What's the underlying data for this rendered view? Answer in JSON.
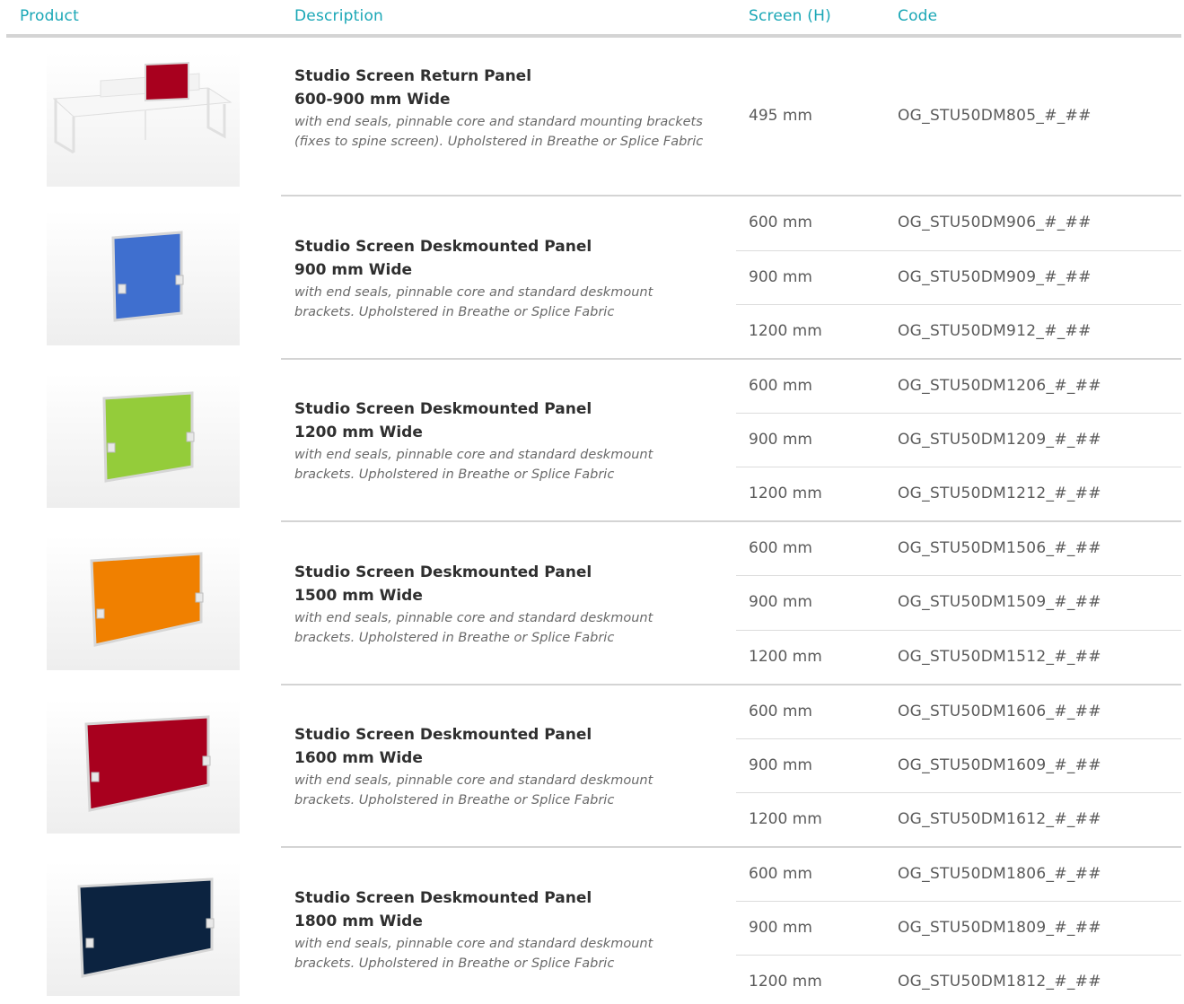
{
  "headers": {
    "product": "Product",
    "description": "Description",
    "screen_h": "Screen (H)",
    "code": "Code"
  },
  "colors": {
    "accent": "#1aa7b6",
    "return_panel": "#a8001e",
    "panel_900": "#3f6fcf",
    "panel_1200": "#94cc3a",
    "panel_1500": "#f08000",
    "panel_1600": "#a8001e",
    "panel_1800": "#0c2340"
  },
  "products": [
    {
      "name": "Studio Screen Return Panel",
      "width": "600-900 mm Wide",
      "details": "with end seals, pinnable core and standard mounting brackets (fixes to spine screen). Upholstered in Breathe or Splice Fabric",
      "variants": [
        {
          "height": "495 mm",
          "code": "OG_STU50DM805_#_##"
        }
      ]
    },
    {
      "name": "Studio Screen Deskmounted Panel",
      "width": "900 mm Wide",
      "details": "with end seals, pinnable core and standard deskmount brackets. Upholstered in Breathe or Splice Fabric",
      "variants": [
        {
          "height": "600 mm",
          "code": "OG_STU50DM906_#_##"
        },
        {
          "height": "900 mm",
          "code": "OG_STU50DM909_#_##"
        },
        {
          "height": "1200 mm",
          "code": "OG_STU50DM912_#_##"
        }
      ]
    },
    {
      "name": "Studio Screen Deskmounted Panel",
      "width": "1200 mm Wide",
      "details": "with end seals, pinnable core and standard deskmount brackets. Upholstered in Breathe or Splice Fabric",
      "variants": [
        {
          "height": "600 mm",
          "code": "OG_STU50DM1206_#_##"
        },
        {
          "height": "900 mm",
          "code": "OG_STU50DM1209_#_##"
        },
        {
          "height": "1200 mm",
          "code": "OG_STU50DM1212_#_##"
        }
      ]
    },
    {
      "name": "Studio Screen Deskmounted Panel",
      "width": "1500 mm Wide",
      "details": "with end seals, pinnable core and standard deskmount brackets. Upholstered in Breathe or Splice Fabric",
      "variants": [
        {
          "height": "600 mm",
          "code": "OG_STU50DM1506_#_##"
        },
        {
          "height": "900 mm",
          "code": "OG_STU50DM1509_#_##"
        },
        {
          "height": "1200 mm",
          "code": "OG_STU50DM1512_#_##"
        }
      ]
    },
    {
      "name": "Studio Screen Deskmounted Panel",
      "width": "1600 mm Wide",
      "details": "with end seals, pinnable core and standard deskmount brackets. Upholstered in Breathe or Splice Fabric",
      "variants": [
        {
          "height": "600 mm",
          "code": "OG_STU50DM1606_#_##"
        },
        {
          "height": "900 mm",
          "code": "OG_STU50DM1609_#_##"
        },
        {
          "height": "1200 mm",
          "code": "OG_STU50DM1612_#_##"
        }
      ]
    },
    {
      "name": "Studio Screen Deskmounted Panel",
      "width": "1800 mm Wide",
      "details": "with end seals, pinnable core and standard deskmount brackets. Upholstered in Breathe or Splice Fabric",
      "variants": [
        {
          "height": "600 mm",
          "code": "OG_STU50DM1806_#_##"
        },
        {
          "height": "900 mm",
          "code": "OG_STU50DM1809_#_##"
        },
        {
          "height": "1200 mm",
          "code": "OG_STU50DM1812_#_##"
        }
      ]
    }
  ]
}
